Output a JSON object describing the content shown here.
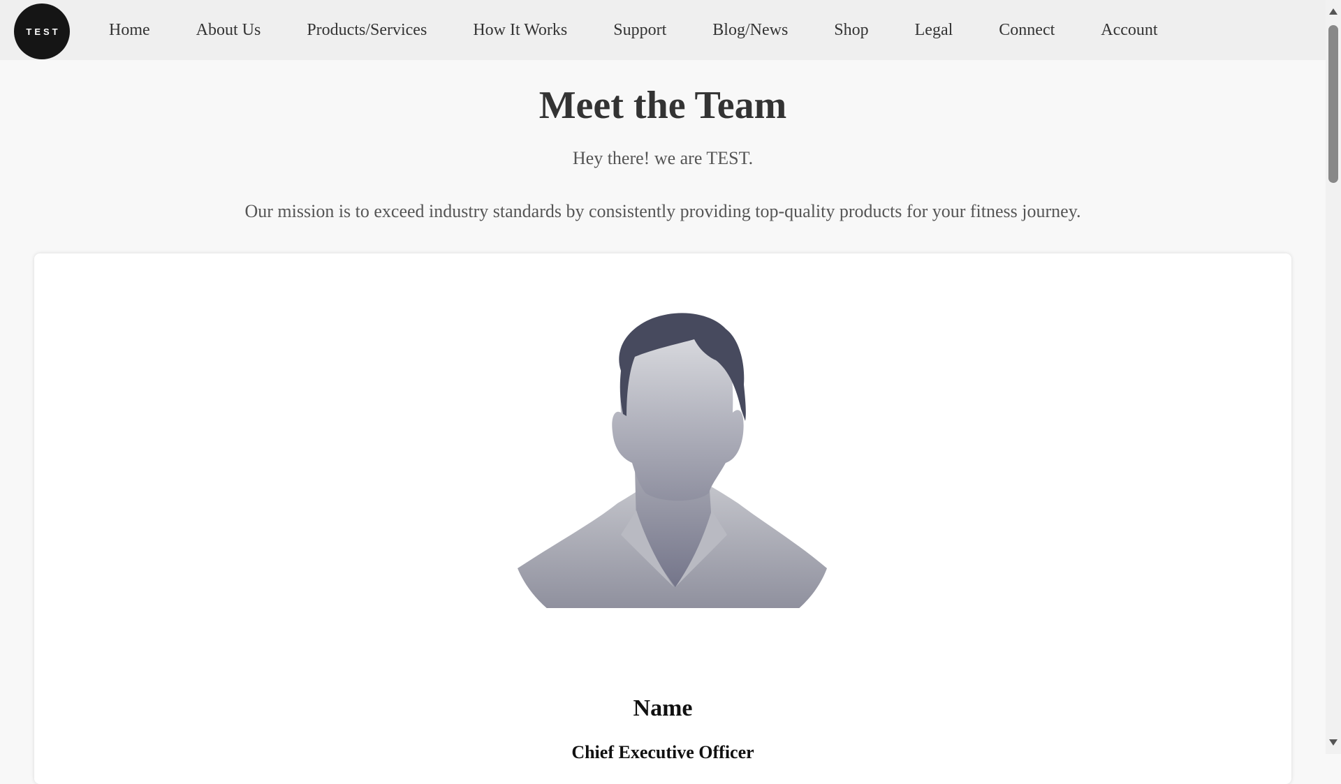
{
  "header": {
    "logo_text": "TEST",
    "nav": [
      {
        "label": "Home"
      },
      {
        "label": "About Us"
      },
      {
        "label": "Products/Services"
      },
      {
        "label": "How It Works"
      },
      {
        "label": "Support"
      },
      {
        "label": "Blog/News"
      },
      {
        "label": "Shop"
      },
      {
        "label": "Legal"
      },
      {
        "label": "Connect"
      },
      {
        "label": "Account"
      }
    ]
  },
  "main": {
    "title": "Meet the Team",
    "intro": "Hey there! we are TEST.",
    "mission": "Our mission is to exceed industry standards by consistently providing top-quality products for your fitness journey.",
    "team": [
      {
        "name": "Name",
        "role": "Chief Executive Officer",
        "avatar_icon": "person-silhouette-icon"
      }
    ]
  },
  "colors": {
    "page_background": "#f8f8f8",
    "nav_background": "#efefef",
    "logo_background": "#151515",
    "card_background": "#ffffff",
    "hair": "#474a5e"
  }
}
